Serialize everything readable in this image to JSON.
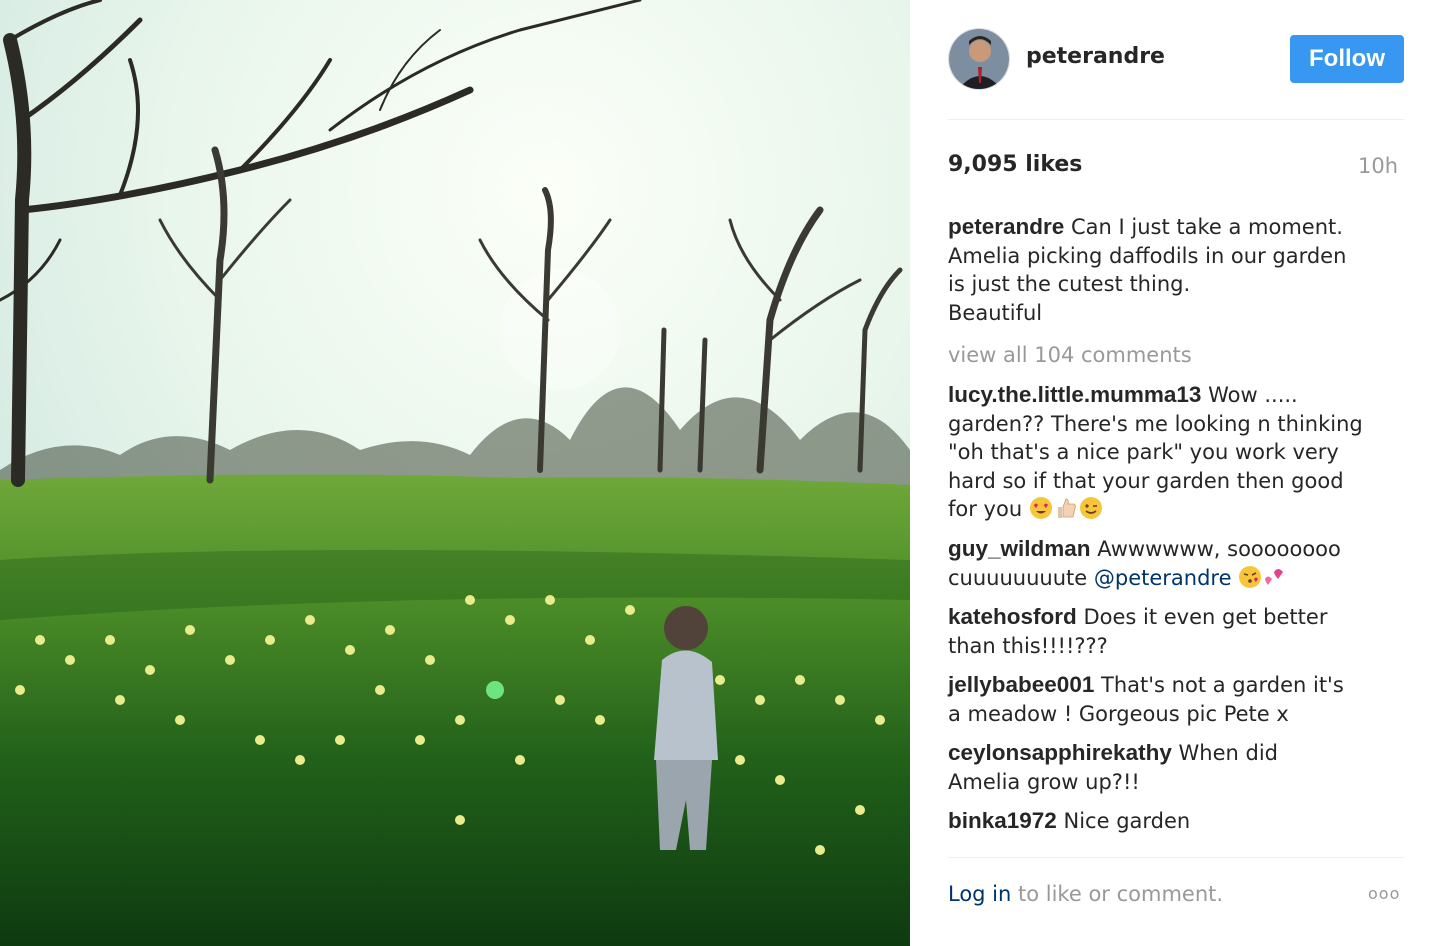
{
  "post": {
    "username": "peterandre",
    "follow_label": "Follow",
    "likes": "9,095 likes",
    "time": "10h",
    "caption_lines": [
      "Can I just take a moment.",
      "Amelia picking daffodils in our garden",
      "is just the cutest thing.",
      "Beautiful"
    ],
    "view_all": "view all 104 comments"
  },
  "comments": [
    {
      "user": "lucy.the.little.mumma13",
      "lines": [
        "Wow .....",
        "garden?? There's me looking n thinking",
        "\"oh that's a nice park\" you work very",
        "hard so if that your garden then good",
        "for you"
      ],
      "emojis": [
        "heart-eyes-emoji",
        "thumbs-up-emoji",
        "wink-emoji"
      ]
    },
    {
      "user": "guy_wildman",
      "lines": [
        "Awwwwww, soooooooo",
        "cuuuuuuuute"
      ],
      "mention": "@peterandre",
      "emojis": [
        "kiss-emoji",
        "hearts-emoji"
      ]
    },
    {
      "user": "katehosford",
      "lines": [
        "Does it even get better",
        "than this!!!!???"
      ]
    },
    {
      "user": "jellybabee001",
      "lines": [
        "That's not a garden it's",
        "a meadow ! Gorgeous pic Pete x"
      ]
    },
    {
      "user": "ceylonsapphirekathy",
      "lines": [
        "When did",
        "Amelia grow up?!!"
      ]
    },
    {
      "user": "binka1972",
      "lines": [
        "Nice garden"
      ]
    }
  ],
  "footer": {
    "login_link": "Log in",
    "login_rest": " to like or comment.",
    "more": "ooo"
  },
  "colors": {
    "follow_bg": "#3897f0",
    "link": "#003569",
    "muted": "#999999"
  }
}
